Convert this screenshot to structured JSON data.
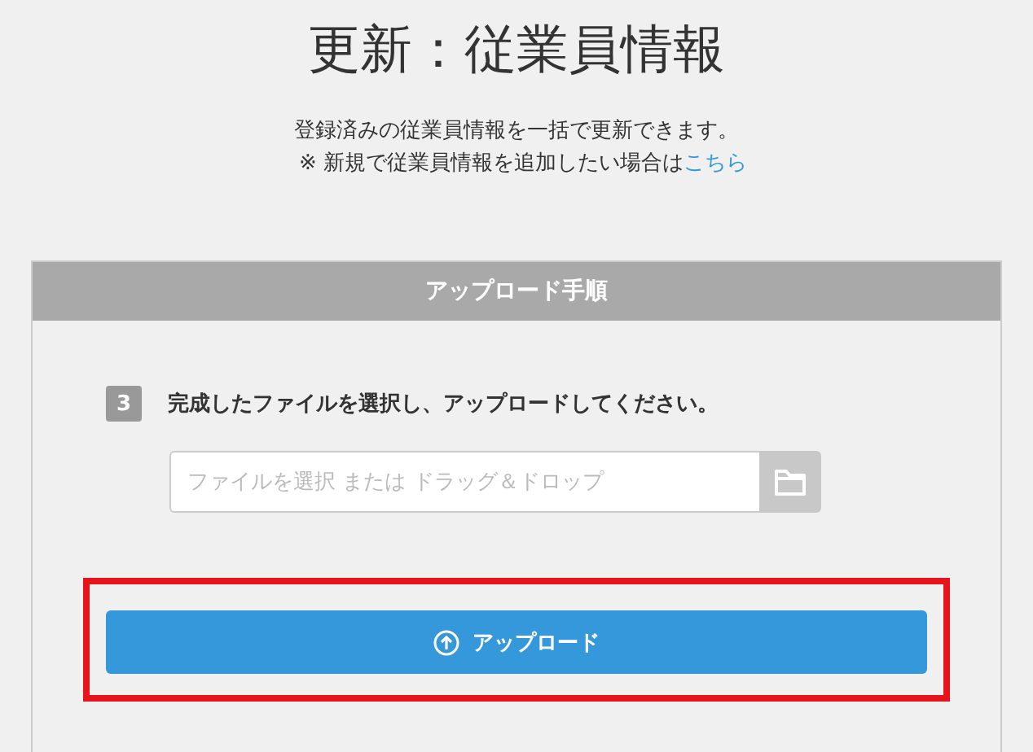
{
  "page": {
    "title": "更新：従業員情報",
    "description": "登録済みの従業員情報を一括で更新できます。",
    "note": {
      "text": "※ 新規で従業員情報を追加したい場合は",
      "link": "こちら"
    }
  },
  "panel": {
    "title": "アップロード手順",
    "step": {
      "number": "3",
      "text": "完成したファイルを選択し、アップロードしてください。"
    },
    "file_field": {
      "placeholder": "ファイルを選択 または ドラッグ＆ドロップ"
    },
    "upload_button": {
      "label": "アップロード",
      "highlighted": true
    }
  }
}
